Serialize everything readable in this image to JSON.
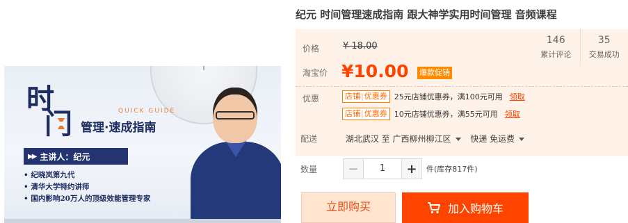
{
  "product": {
    "title": "纪元 时间管理速成指南 跟大神学实用时间管理 音频课程"
  },
  "image": {
    "big_chars": [
      "时",
      "门"
    ],
    "quick_guide": "QUICK GUIDE",
    "guide_title": "管理·速成指南",
    "lecturer": "主讲人：纪元",
    "bio": [
      "• 纪晓岚第九代",
      "• 清华大学特约讲师",
      "• 国内影响20万人的顶级效能管理专家"
    ]
  },
  "price": {
    "label": "价格",
    "original": "¥ 18.00",
    "promo_label": "淘宝价",
    "current": "¥10.00",
    "promo_tag": "爆款促销"
  },
  "stats": [
    {
      "num": "146",
      "label": "累计评论"
    },
    {
      "num": "35",
      "label": "交易成功"
    }
  ],
  "discount": {
    "label": "优惠",
    "coupons": [
      {
        "tag_a": "店铺",
        "tag_b": "优惠券",
        "desc": "25元店铺优惠券，满100元可用",
        "link": "领取"
      },
      {
        "tag_a": "店铺",
        "tag_b": "优惠券",
        "desc": "10元店铺优惠券，满55元可用",
        "link": "领取"
      }
    ]
  },
  "shipping": {
    "label": "配送",
    "from": "湖北武汉",
    "to_word": "至",
    "destination": "广西柳州柳江区",
    "method": "快递 免运费"
  },
  "quantity": {
    "label": "数量",
    "minus": "−",
    "value": "1",
    "plus": "+",
    "stock": "件(库存817件)"
  },
  "actions": {
    "buy_now": "立即购买",
    "add_to_cart": "加入购物车"
  },
  "colors": {
    "accent": "#ff4400",
    "panel_bg": "#fff2e8",
    "promo_tag": "#ff8a00"
  }
}
